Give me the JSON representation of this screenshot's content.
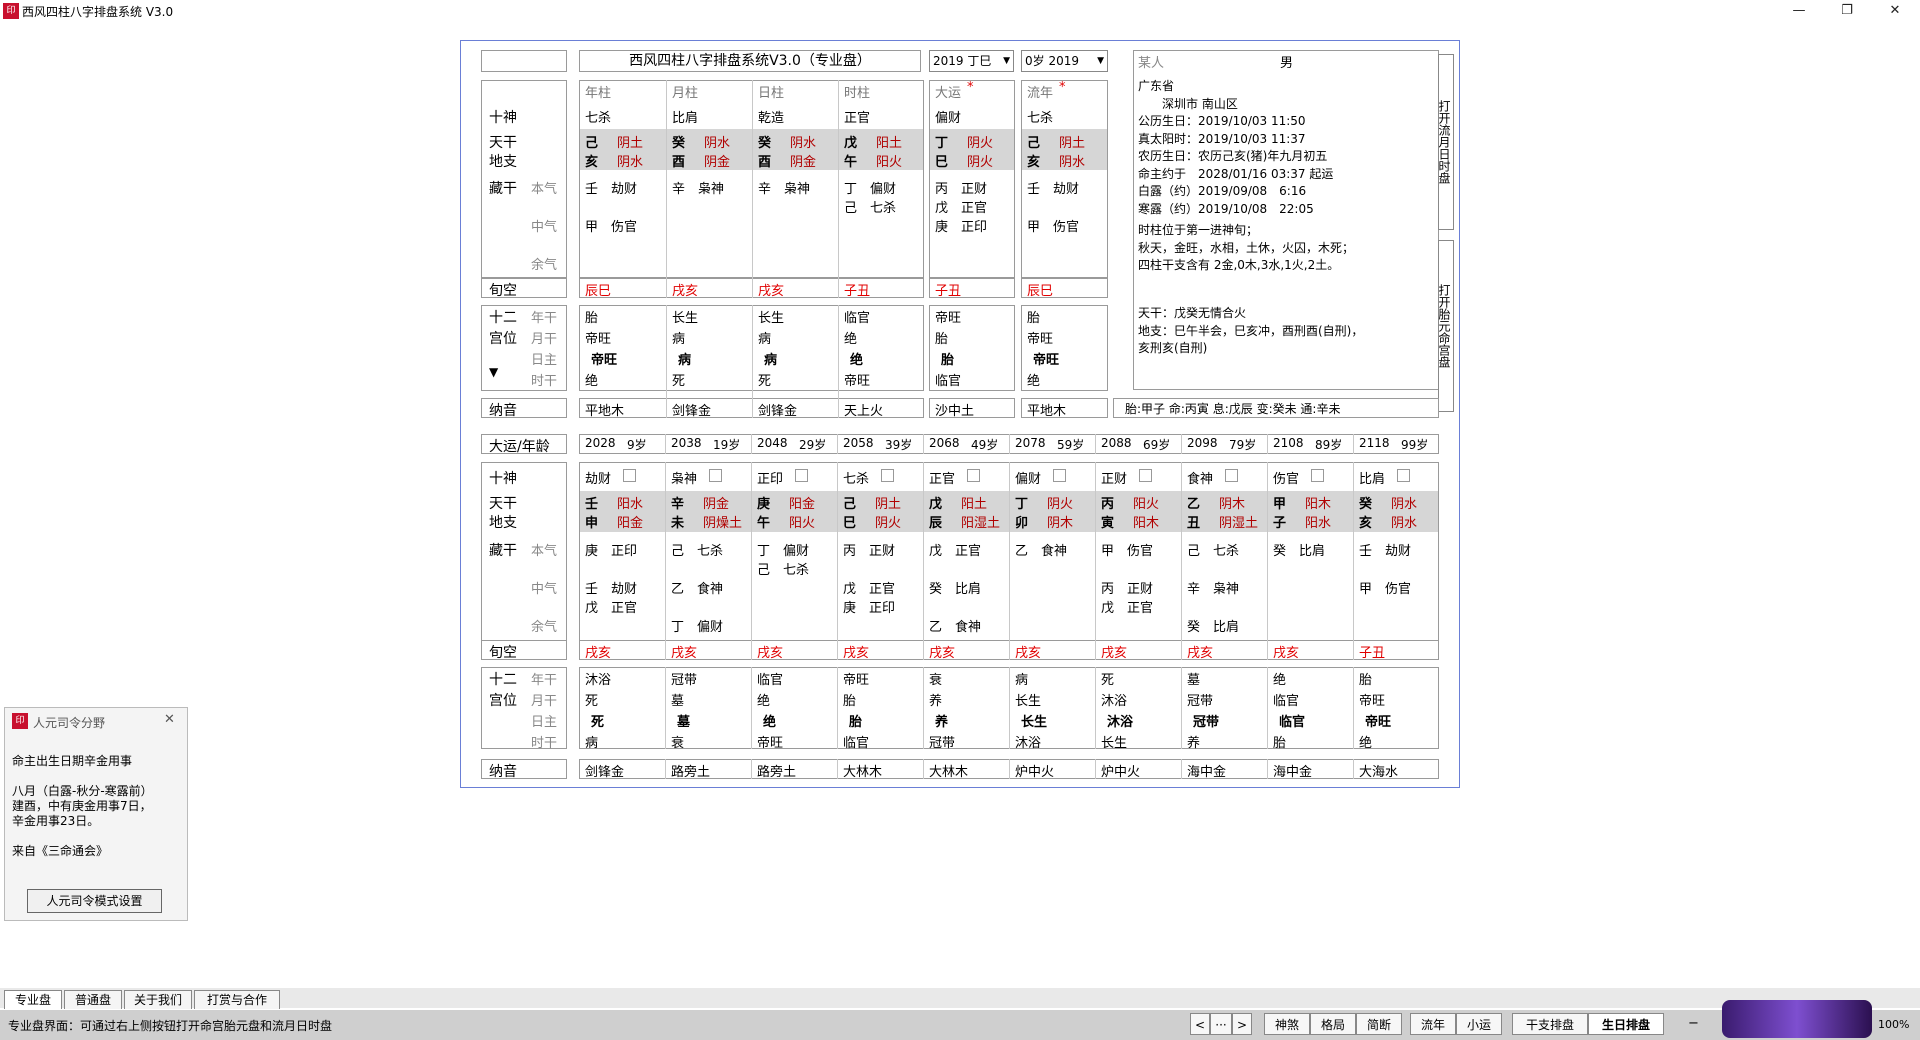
{
  "window": {
    "title": "西风四柱八字排盘系统 V3.0",
    "icon": "app-seal",
    "min": "—",
    "max": "❐",
    "close": "✕"
  },
  "left_blank": "",
  "header": {
    "title": "西风四柱八字排盘系统V3.0（专业盘）",
    "dayun_select": "2019 丁巳",
    "liunian_select": "0岁 2019"
  },
  "person": {
    "name": "某人",
    "gender": "男"
  },
  "pillar_headers": [
    "年柱",
    "月柱",
    "日柱",
    "时柱",
    "大运",
    "流年"
  ],
  "row_labels": {
    "shishen": "十神",
    "tiangan": "天干",
    "dizhi": "地支",
    "canggan": "藏干",
    "benqi": "本气",
    "zhongqi": "中气",
    "yuqi": "余气",
    "xunkong": "旬空",
    "shier": "十二",
    "gongwei": "宫位",
    "nian": "年干",
    "yue": "月干",
    "ri": "日主",
    "shi": "时干",
    "nayin": "纳音",
    "dayun_age": "大运/年龄",
    "arrow": "▼"
  },
  "pillars": [
    {
      "shishen": "七杀",
      "gan": "己",
      "gan_wx": "阴土",
      "zhi": "亥",
      "zhi_wx": "阴水",
      "benqi": "壬　劫财",
      "zhongqi": "甲　伤官",
      "yuqi": "",
      "xunkong": "辰巳",
      "cs": [
        "胎",
        "帝旺",
        "帝旺",
        "绝"
      ],
      "nayin": "平地木"
    },
    {
      "shishen": "比肩",
      "gan": "癸",
      "gan_wx": "阴水",
      "zhi": "酉",
      "zhi_wx": "阴金",
      "benqi": "辛　枭神",
      "zhongqi": "",
      "yuqi": "",
      "xunkong": "戌亥",
      "cs": [
        "长生",
        "病",
        "病",
        "死"
      ],
      "nayin": "剑锋金"
    },
    {
      "shishen": "乾造",
      "gan": "癸",
      "gan_wx": "阴水",
      "zhi": "酉",
      "zhi_wx": "阴金",
      "benqi": "辛　枭神",
      "zhongqi": "",
      "yuqi": "",
      "xunkong": "戌亥",
      "cs": [
        "长生",
        "病",
        "病",
        "死"
      ],
      "nayin": "剑锋金"
    },
    {
      "shishen": "正官",
      "gan": "戊",
      "gan_wx": "阳土",
      "zhi": "午",
      "zhi_wx": "阳火",
      "benqi": "丁　偏财",
      "benqi2": "己　七杀",
      "zhongqi": "",
      "yuqi": "",
      "xunkong": "子丑",
      "cs": [
        "临官",
        "绝",
        "绝",
        "帝旺"
      ],
      "nayin": "天上火"
    },
    {
      "shishen": "偏财",
      "gan": "丁",
      "gan_wx": "阴火",
      "zhi": "巳",
      "zhi_wx": "阴火",
      "benqi": "丙　正财",
      "benqi2": "戊　正官",
      "benqi3": "庚　正印",
      "zhongqi": "",
      "yuqi": "",
      "xunkong": "子丑",
      "cs": [
        "帝旺",
        "胎",
        "胎",
        "临官"
      ],
      "nayin": "沙中土"
    },
    {
      "shishen": "七杀",
      "gan": "己",
      "gan_wx": "阴土",
      "zhi": "亥",
      "zhi_wx": "阴水",
      "benqi": "壬　劫财",
      "zhongqi": "甲　伤官",
      "yuqi": "",
      "xunkong": "辰巳",
      "cs": [
        "胎",
        "帝旺",
        "帝旺",
        "绝"
      ],
      "nayin": "平地木"
    }
  ],
  "info": {
    "lines": [
      "广东省",
      "　　深圳市 南山区",
      "公历生日：2019/10/03 11:50",
      "真太阳时：2019/10/03 11:37",
      "农历生日：农历己亥(猪)年九月初五",
      "命主约于　2028/01/16 03:37 起运",
      "白露（约）2019/09/08　6:16",
      "寒露（约）2019/10/08　22:05"
    ],
    "lines2": [
      "时柱位于第一进神旬；",
      "秋天，金旺，水相，土休，火囚，木死；",
      "四柱干支含有 2金,0木,3水,1火,2土。"
    ],
    "lines3": [
      "天干：戊癸无情合火",
      "地支：巳午半会，巳亥冲，酉刑酉(自刑)，",
      "亥刑亥(自刑)"
    ],
    "taiyuan": "胎:甲子 命:丙寅 息:戊辰 变:癸未 通:辛未"
  },
  "side_tabs": {
    "liuyue": "打开流月日时盘",
    "taiyuan": "打开胎元命宫盘"
  },
  "dayun": [
    {
      "year": "2028",
      "age": "9岁",
      "shishen": "劫财",
      "gan": "壬",
      "gan_wx": "阳水",
      "zhi": "申",
      "zhi_wx": "阳金",
      "cg": [
        "庚　正印",
        "",
        "壬　劫财",
        "戊　正官",
        ""
      ],
      "xk": "戌亥",
      "cs": [
        "沐浴",
        "死",
        "死",
        "病"
      ],
      "nayin": "剑锋金"
    },
    {
      "year": "2038",
      "age": "19岁",
      "shishen": "枭神",
      "gan": "辛",
      "gan_wx": "阴金",
      "zhi": "未",
      "zhi_wx": "阴燥土",
      "cg": [
        "己　七杀",
        "",
        "乙　食神",
        "",
        "丁　偏财"
      ],
      "xk": "戌亥",
      "cs": [
        "冠带",
        "墓",
        "墓",
        "衰"
      ],
      "nayin": "路旁土"
    },
    {
      "year": "2048",
      "age": "29岁",
      "shishen": "正印",
      "gan": "庚",
      "gan_wx": "阳金",
      "zhi": "午",
      "zhi_wx": "阳火",
      "cg": [
        "丁　偏财",
        "己　七杀",
        "",
        "",
        ""
      ],
      "xk": "戌亥",
      "cs": [
        "临官",
        "绝",
        "绝",
        "帝旺"
      ],
      "nayin": "路旁土"
    },
    {
      "year": "2058",
      "age": "39岁",
      "shishen": "七杀",
      "gan": "己",
      "gan_wx": "阴土",
      "zhi": "巳",
      "zhi_wx": "阴火",
      "cg": [
        "丙　正财",
        "",
        "戊　正官",
        "庚　正印",
        ""
      ],
      "xk": "戌亥",
      "cs": [
        "帝旺",
        "胎",
        "胎",
        "临官"
      ],
      "nayin": "大林木"
    },
    {
      "year": "2068",
      "age": "49岁",
      "shishen": "正官",
      "gan": "戊",
      "gan_wx": "阳土",
      "zhi": "辰",
      "zhi_wx": "阳湿土",
      "cg": [
        "戊　正官",
        "",
        "癸　比肩",
        "",
        "乙　食神"
      ],
      "xk": "戌亥",
      "cs": [
        "衰",
        "养",
        "养",
        "冠带"
      ],
      "nayin": "大林木"
    },
    {
      "year": "2078",
      "age": "59岁",
      "shishen": "偏财",
      "gan": "丁",
      "gan_wx": "阴火",
      "zhi": "卯",
      "zhi_wx": "阴木",
      "cg": [
        "乙　食神",
        "",
        "",
        "",
        ""
      ],
      "xk": "戌亥",
      "cs": [
        "病",
        "长生",
        "长生",
        "沐浴"
      ],
      "nayin": "炉中火"
    },
    {
      "year": "2088",
      "age": "69岁",
      "shishen": "正财",
      "gan": "丙",
      "gan_wx": "阳火",
      "zhi": "寅",
      "zhi_wx": "阳木",
      "cg": [
        "甲　伤官",
        "",
        "丙　正财",
        "戊　正官",
        ""
      ],
      "xk": "戌亥",
      "cs": [
        "死",
        "沐浴",
        "沐浴",
        "长生"
      ],
      "nayin": "炉中火"
    },
    {
      "year": "2098",
      "age": "79岁",
      "shishen": "食神",
      "gan": "乙",
      "gan_wx": "阴木",
      "zhi": "丑",
      "zhi_wx": "阴湿土",
      "cg": [
        "己　七杀",
        "",
        "辛　枭神",
        "",
        "癸　比肩"
      ],
      "xk": "戌亥",
      "cs": [
        "墓",
        "冠带",
        "冠带",
        "养"
      ],
      "nayin": "海中金"
    },
    {
      "year": "2108",
      "age": "89岁",
      "shishen": "伤官",
      "gan": "甲",
      "gan_wx": "阳木",
      "zhi": "子",
      "zhi_wx": "阳水",
      "cg": [
        "癸　比肩",
        "",
        "",
        "",
        ""
      ],
      "xk": "戌亥",
      "cs": [
        "绝",
        "临官",
        "临官",
        "胎"
      ],
      "nayin": "海中金"
    },
    {
      "year": "2118",
      "age": "99岁",
      "shishen": "比肩",
      "gan": "癸",
      "gan_wx": "阴水",
      "zhi": "亥",
      "zhi_wx": "阴水",
      "cg": [
        "壬　劫财",
        "",
        "甲　伤官",
        "",
        ""
      ],
      "xk": "子丑",
      "cs": [
        "胎",
        "帝旺",
        "帝旺",
        "绝"
      ],
      "nayin": "大海水"
    }
  ],
  "popup": {
    "title": "人元司令分野",
    "close": "✕",
    "line1": "命主出生日期辛金用事",
    "line2": "八月（白露-秋分-寒露前）",
    "line3": "建酉，中有庚金用事7日，",
    "line4": "辛金用事23日。",
    "line5": "来自《三命通会》",
    "button": "人元司令模式设置"
  },
  "tabs": [
    "专业盘",
    "普通盘",
    "关于我们",
    "打赏与合作"
  ],
  "status": {
    "text": "专业盘界面：可通过右上侧按钮打开命宫胎元盘和流月日时盘",
    "nav_prev": "<",
    "nav_more": "···",
    "nav_next": ">",
    "b1": "神煞",
    "b2": "格局",
    "b3": "简断",
    "b4": "流年",
    "b5": "小运",
    "b6": "干支排盘",
    "b7": "生日排盘",
    "zoom_minus": "−",
    "zoom": "100%"
  },
  "colors": {
    "frame": "#6a7fd6",
    "red": "#e00000",
    "dark_red": "#b00000",
    "shade": "#d6d6d6"
  }
}
